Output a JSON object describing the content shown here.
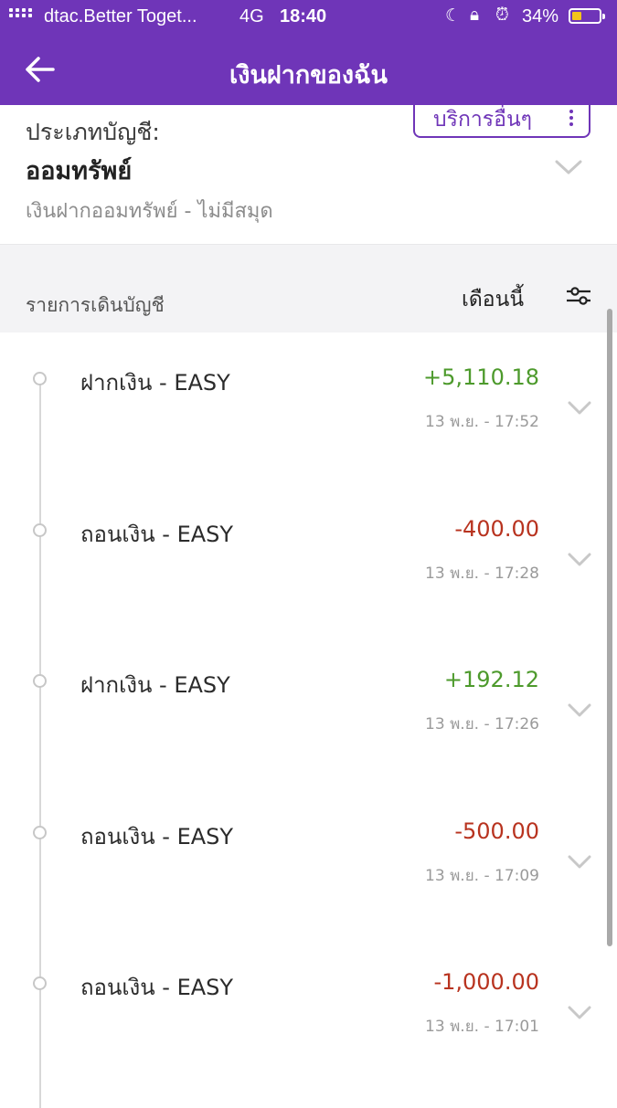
{
  "status": {
    "carrier": "dtac.Better Toget...",
    "network": "4G",
    "time": "18:40",
    "battery": "34%"
  },
  "header": {
    "title": "เงินฝากของฉัน"
  },
  "account": {
    "label": "ประเภทบัญชี:",
    "type": "ออมทรัพย์",
    "subtype": "เงินฝากออมทรัพย์ - ไม่มีสมุด",
    "services_label": "บริการอื่นๆ"
  },
  "list": {
    "title": "รายการเดินบัญชี",
    "filter": "เดือนนี้"
  },
  "transactions": [
    {
      "name": "ฝากเงิน - EASY",
      "amount": "+5,110.18",
      "date": "13 พ.ย. - 17:52",
      "kind": "deposit"
    },
    {
      "name": "ถอนเงิน - EASY",
      "amount": "-400.00",
      "date": "13 พ.ย. - 17:28",
      "kind": "withdraw"
    },
    {
      "name": "ฝากเงิน - EASY",
      "amount": "+192.12",
      "date": "13 พ.ย. - 17:26",
      "kind": "deposit"
    },
    {
      "name": "ถอนเงิน - EASY",
      "amount": "-500.00",
      "date": "13 พ.ย. - 17:09",
      "kind": "withdraw"
    },
    {
      "name": "ถอนเงิน - EASY",
      "amount": "-1,000.00",
      "date": "13 พ.ย. - 17:01",
      "kind": "withdraw"
    }
  ],
  "colors": {
    "brand": "#6f35b8",
    "deposit": "#4d9a2c",
    "withdraw": "#b8331f"
  }
}
